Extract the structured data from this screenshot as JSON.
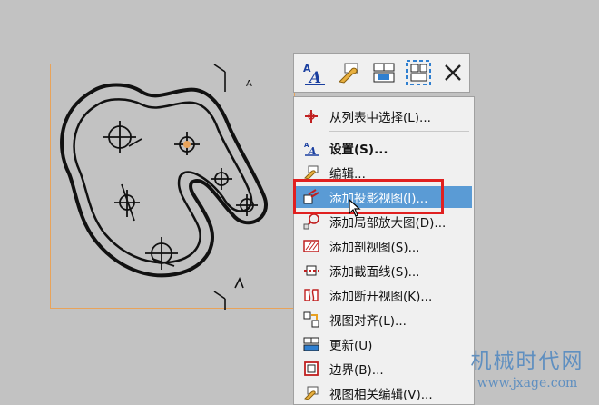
{
  "drawing": {
    "section_label": "A"
  },
  "toolbar": {
    "buttons": [
      {
        "icon": "text-style-icon"
      },
      {
        "icon": "edit-wrench-icon"
      },
      {
        "icon": "view-grid-icon"
      },
      {
        "icon": "view-selection-icon"
      },
      {
        "icon": "close-icon"
      }
    ]
  },
  "menu": {
    "items": [
      {
        "label": "从列表中选择(L)...",
        "icon": "select-crosshair-icon"
      },
      {
        "label": "设置(S)...",
        "icon": "text-style-icon"
      },
      {
        "label": "编辑...",
        "icon": "edit-icon"
      },
      {
        "label": "添加投影视图(I)...",
        "icon": "projected-view-icon"
      },
      {
        "label": "添加局部放大图(D)...",
        "icon": "detail-view-icon"
      },
      {
        "label": "添加剖视图(S)...",
        "icon": "section-view-icon"
      },
      {
        "label": "添加截面线(S)...",
        "icon": "section-line-icon"
      },
      {
        "label": "添加断开视图(K)...",
        "icon": "broken-view-icon"
      },
      {
        "label": "视图对齐(L)...",
        "icon": "view-align-icon"
      },
      {
        "label": "更新(U)",
        "icon": "update-icon"
      },
      {
        "label": "边界(B)...",
        "icon": "boundary-icon"
      },
      {
        "label": "视图相关编辑(V)...",
        "icon": "view-dependent-edit-icon"
      }
    ]
  },
  "watermark": {
    "line1": "机械时代网",
    "line2": "www.jxage.com"
  },
  "colors": {
    "background": "#c2c2c2",
    "menu_bg": "#f0f0f0",
    "highlight": "#5a9bd5",
    "callout_border": "#e02020",
    "view_border": "#e8a35a",
    "watermark": "#5f8fc0"
  }
}
